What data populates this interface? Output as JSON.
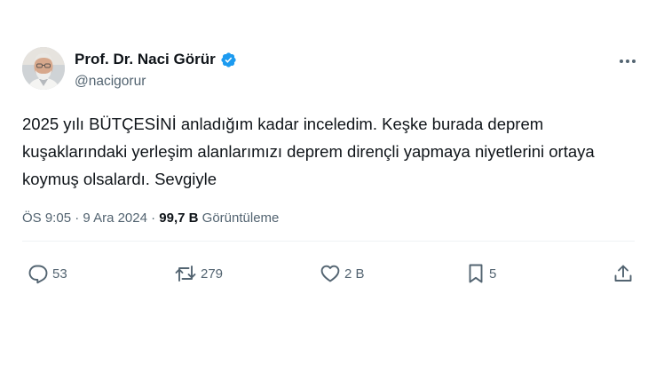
{
  "author": {
    "name": "Prof. Dr. Naci Görür",
    "handle": "@nacigorur",
    "verified": true
  },
  "tweet": {
    "text": "2025 yılı BÜTÇESİNİ anladığım kadar inceledim. Keşke burada deprem kuşaklarındaki yerleşim alanlarımızı deprem dirençli yapmaya niyetlerini ortaya koymuş olsalardı. Sevgiyle"
  },
  "meta": {
    "time": "ÖS 9:05",
    "separator": "·",
    "date": "9 Ara 2024",
    "views_count": "99,7 B",
    "views_label": "Görüntüleme"
  },
  "actions": {
    "replies": "53",
    "reposts": "279",
    "likes": "2 B",
    "bookmarks": "5"
  },
  "colors": {
    "verified_badge": "#1d9bf0",
    "icon_gray": "#536471",
    "text_primary": "#0f1419"
  },
  "icons": {
    "more": "more-dots-icon",
    "reply": "reply-icon",
    "repost": "repost-icon",
    "like": "heart-icon",
    "bookmark": "bookmark-icon",
    "share": "share-icon",
    "verified": "verified-badge-icon"
  }
}
